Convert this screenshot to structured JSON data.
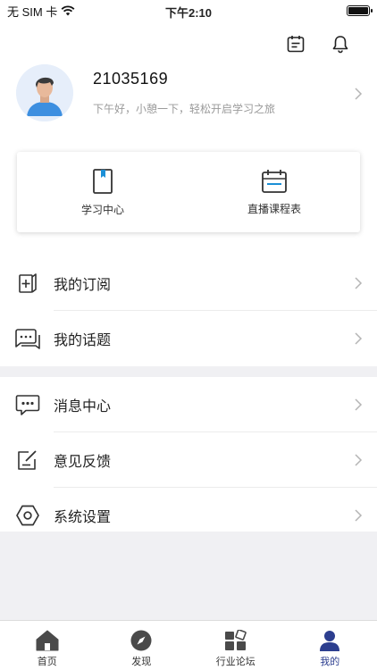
{
  "status_bar": {
    "carrier": "无 SIM 卡",
    "time": "下午2:10"
  },
  "header_icons": [
    "calendar-icon",
    "bell-icon"
  ],
  "profile": {
    "username": "21035169",
    "greeting": "下午好，小憩一下，轻松开启学习之旅"
  },
  "quick_actions": [
    {
      "label": "学习中心",
      "icon": "book-icon"
    },
    {
      "label": "直播课程表",
      "icon": "schedule-icon"
    }
  ],
  "menu_group_1": [
    {
      "label": "我的订阅",
      "icon": "subscribe-icon"
    },
    {
      "label": "我的话题",
      "icon": "topic-icon"
    }
  ],
  "menu_group_2": [
    {
      "label": "消息中心",
      "icon": "message-icon"
    },
    {
      "label": "意见反馈",
      "icon": "feedback-icon"
    },
    {
      "label": "系统设置",
      "icon": "settings-icon"
    }
  ],
  "tabs": [
    {
      "label": "首页",
      "icon": "home-icon"
    },
    {
      "label": "发现",
      "icon": "compass-icon"
    },
    {
      "label": "行业论坛",
      "icon": "forum-icon"
    },
    {
      "label": "我的",
      "icon": "user-icon"
    }
  ],
  "active_tab": "我的",
  "colors": {
    "accent": "#2c3e8f",
    "background_gray": "#f0f0f3",
    "card_icon_blue": "#1b8fd6"
  }
}
